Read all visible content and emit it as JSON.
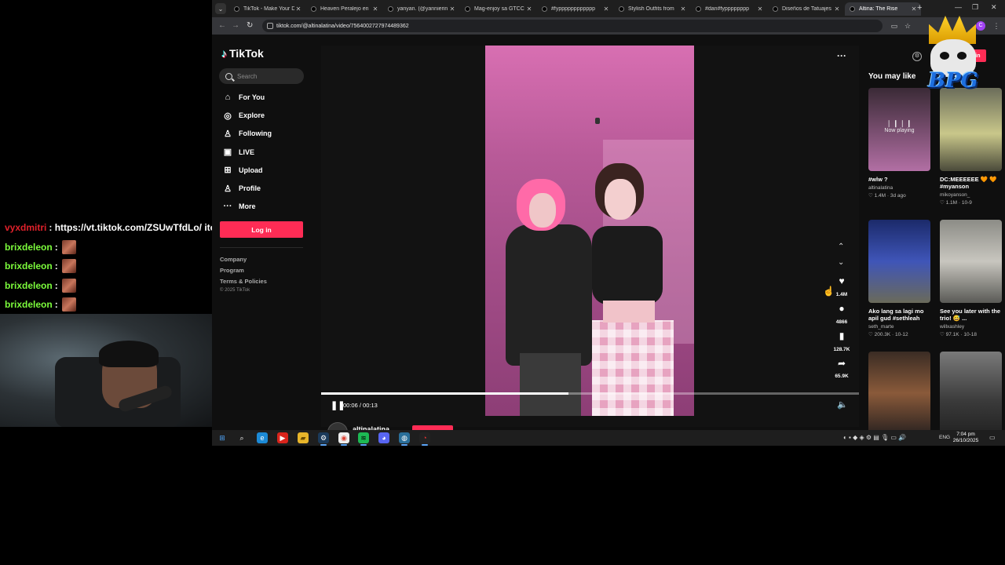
{
  "chat": [
    {
      "user": "vyxdmitri",
      "color": "#e0212b",
      "message": ": https://vt.tiktok.com/ZSUwTfdLo/ ito din HAHA",
      "emote": false
    },
    {
      "user": "brixdeleon",
      "color": "#7cfc3c",
      "message": ":",
      "emote": true
    },
    {
      "user": "brixdeleon",
      "color": "#7cfc3c",
      "message": ":",
      "emote": true
    },
    {
      "user": "brixdeleon",
      "color": "#7cfc3c",
      "message": ":",
      "emote": true
    },
    {
      "user": "brixdeleon",
      "color": "#7cfc3c",
      "message": ":",
      "emote": true
    }
  ],
  "browser": {
    "tabs": [
      {
        "label": "TikTok - Make Your D",
        "active": false
      },
      {
        "label": "Heaven Peralejo en",
        "active": false
      },
      {
        "label": "yanyan. (@yannierin",
        "active": false
      },
      {
        "label": "Mag-enjoy sa GTCC",
        "active": false
      },
      {
        "label": "#fypppppppppppp",
        "active": false
      },
      {
        "label": "Stylish Outfits from",
        "active": false
      },
      {
        "label": "#dan#fypppppppp",
        "active": false
      },
      {
        "label": "Diseños de Tatuajes",
        "active": false
      },
      {
        "label": "Altina: The Rise",
        "active": true
      }
    ],
    "url": "tiktok.com/@altinalatina/video/7564002727974489362",
    "new_tab": "+",
    "minimize": "—",
    "maximize": "❐",
    "close": "✕",
    "profile_initial": "C"
  },
  "tiktok": {
    "logo": "TikTok",
    "search_placeholder": "Search",
    "nav": [
      {
        "label": "For You",
        "icon": "home-icon",
        "glyph": "⌂"
      },
      {
        "label": "Explore",
        "icon": "compass-icon",
        "glyph": "◎"
      },
      {
        "label": "Following",
        "icon": "following-icon",
        "glyph": "♙"
      },
      {
        "label": "LIVE",
        "icon": "live-icon",
        "glyph": "▣"
      },
      {
        "label": "Upload",
        "icon": "upload-icon",
        "glyph": "⊞"
      },
      {
        "label": "Profile",
        "icon": "profile-icon",
        "glyph": "♙"
      },
      {
        "label": "More",
        "icon": "more-icon",
        "glyph": "···"
      }
    ],
    "login_label": "Log in",
    "footer": [
      "Company",
      "Program",
      "Terms & Policies"
    ],
    "copyright": "© 2025 TikTok"
  },
  "video": {
    "time": "00:06 / 00:13",
    "progress": 0.46,
    "author": "altinalatina",
    "likes": "1.4M",
    "comments": "4866",
    "saves": "128.7K",
    "shares": "65.9K"
  },
  "rail": {
    "title": "You may like",
    "login_label": "Log in",
    "now_playing": "Now playing",
    "cards": [
      {
        "title": "#wlw ?",
        "user": "altinalatina",
        "stats": "♡ 1.4M · 3d ago",
        "thumb": "linear-gradient(180deg,#3a2a36,#b26fa4)",
        "playing": true
      },
      {
        "title": "DC:MEEEEEE 🧡 🧡 #myanson",
        "user": "mikoyanson_",
        "stats": "♡ 1.1M · 10-9",
        "thumb": "linear-gradient(180deg,#6b6d5a,#c9c78a 55%,#4a4a3a)",
        "playing": false
      },
      {
        "title": "Ako lang sa lagi mo apil gud #sethleah",
        "user": "seth_marte",
        "stats": "♡ 200.3K · 10-12",
        "thumb": "linear-gradient(180deg,#1b2a6a,#3f55b8 50%,#6a6a5a)",
        "playing": false
      },
      {
        "title": "See you later with the trio! 😅 ...",
        "user": "willxashley",
        "stats": "♡ 97.1K · 10-18",
        "thumb": "linear-gradient(180deg,#8c8c86,#c8c6bf 50%,#5a5a56)",
        "playing": false
      },
      {
        "title": "",
        "user": "",
        "stats": "",
        "thumb": "linear-gradient(180deg,#3a2c24,#8a5a3a 50%,#2a2220)",
        "playing": false
      },
      {
        "title": "",
        "user": "",
        "stats": "",
        "thumb": "linear-gradient(180deg,#7a7a7a,#3a3a3a 60%,#222)",
        "playing": false
      }
    ]
  },
  "crest_text": "BPG",
  "taskbar": {
    "apps": [
      {
        "name": "start-icon",
        "glyph": "⊞",
        "bg": "transparent",
        "color": "#4ea3f7"
      },
      {
        "name": "search-icon",
        "glyph": "⌕",
        "bg": "transparent",
        "color": "#fff"
      },
      {
        "name": "edge-icon",
        "glyph": "e",
        "bg": "#1c8ad6",
        "color": "#fff"
      },
      {
        "name": "youtube-icon",
        "glyph": "▶",
        "bg": "#d9241c",
        "color": "#fff"
      },
      {
        "name": "folder-icon",
        "glyph": "▰",
        "bg": "#e8b52a",
        "color": "#6b4b00"
      },
      {
        "name": "steam-icon",
        "glyph": "⚙",
        "bg": "#1b3a5a",
        "color": "#fff"
      },
      {
        "name": "chrome-icon",
        "glyph": "◉",
        "bg": "#eee",
        "color": "#db4437"
      },
      {
        "name": "spotify-icon",
        "glyph": "≋",
        "bg": "#1db954",
        "color": "#000"
      },
      {
        "name": "discord-icon",
        "glyph": "◕",
        "bg": "#5865f2",
        "color": "#fff"
      },
      {
        "name": "app-icon",
        "glyph": "◍",
        "bg": "#2a6f9a",
        "color": "#fff"
      },
      {
        "name": "obs-icon",
        "glyph": "◔",
        "bg": "#222",
        "color": "#e33"
      }
    ],
    "lang": "ENG",
    "time": "7:04 pm",
    "date": "26/10/2025"
  }
}
